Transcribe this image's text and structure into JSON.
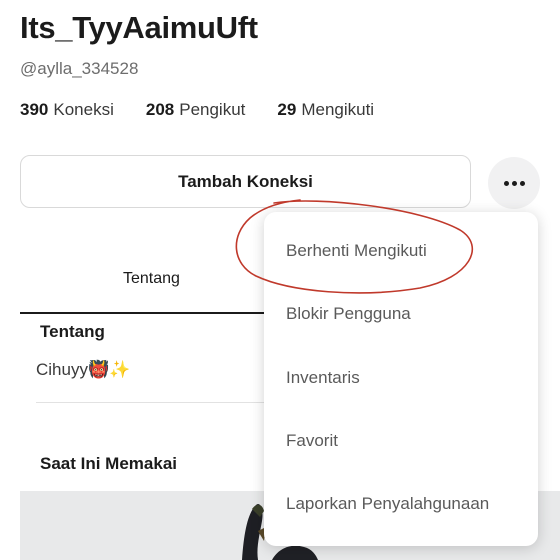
{
  "profile": {
    "display_name": "Its_TyyAaimuUft",
    "username": "@aylla_334528"
  },
  "stats": [
    {
      "value": "390",
      "label": "Koneksi"
    },
    {
      "value": "208",
      "label": "Pengikut"
    },
    {
      "value": "29",
      "label": "Mengikuti"
    }
  ],
  "actions": {
    "add_connection_label": "Tambah Koneksi",
    "more_icon": "more-horizontal-icon"
  },
  "tabs": {
    "about_label": "Tentang"
  },
  "about": {
    "title": "Tentang",
    "text": "Cihuyy👹✨"
  },
  "wearing": {
    "title": "Saat Ini Memakai"
  },
  "menu": {
    "items": [
      {
        "label": "Berhenti Mengikuti"
      },
      {
        "label": "Blokir Pengguna"
      },
      {
        "label": "Inventaris"
      },
      {
        "label": "Favorit"
      },
      {
        "label": "Laporkan Penyalahgunaan"
      }
    ]
  },
  "annotation_color": "#c0392b"
}
